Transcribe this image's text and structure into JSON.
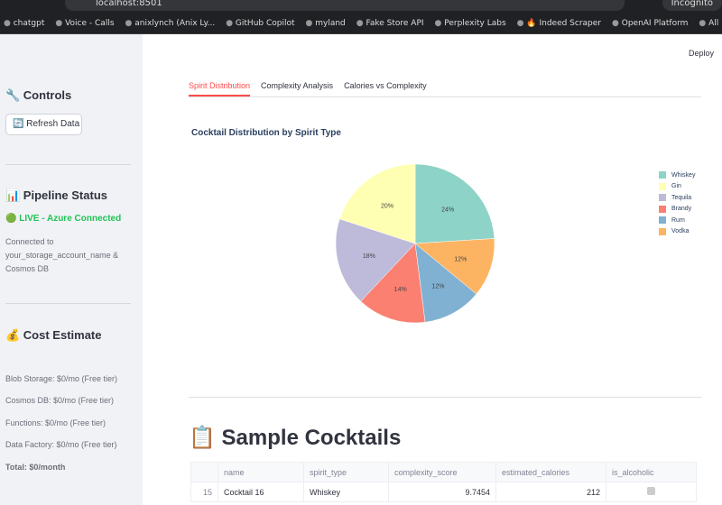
{
  "browser": {
    "url": "localhost:8501",
    "incognito": "Incognito",
    "bookmarks": [
      "chatgpt",
      "Voice - Calls",
      "anixlynch (Anix Ly...",
      "GitHub Copilot",
      "myland",
      "Fake Store API",
      "Perplexity Labs",
      "🔥 Indeed Scraper",
      "OpenAI Platform",
      "All Bookmarks"
    ]
  },
  "sidebar": {
    "controls": "🔧 Controls",
    "refresh": "🔄 Refresh Data",
    "pipeline": "📊 Pipeline Status",
    "live": "🟢 LIVE - Azure Connected",
    "connected": "Connected to your_storage_account_name & Cosmos DB",
    "cost": "💰 Cost Estimate",
    "costs": [
      "Blob Storage: $0/mo (Free tier)",
      "Cosmos DB: $0/mo (Free tier)",
      "Functions: $0/mo (Free tier)",
      "Data Factory: $0/mo (Free tier)"
    ],
    "total": "Total: $0/month"
  },
  "main": {
    "deploy": "Deploy",
    "tabs": [
      "Spirit Distribution",
      "Complexity Analysis",
      "Calories vs Complexity"
    ],
    "active_tab": 0,
    "section": "📋 Sample Cocktails"
  },
  "table": {
    "headers": [
      "",
      "name",
      "spirit_type",
      "complexity_score",
      "estimated_calories",
      "is_alcoholic"
    ],
    "rows": [
      {
        "idx": "15",
        "name": "Cocktail 16",
        "spirit": "Whiskey",
        "complexity": "9.7454",
        "calories": "212",
        "alcoholic": false
      }
    ]
  },
  "chart_data": {
    "type": "pie",
    "title": "Cocktail Distribution by Spirit Type",
    "legend_position": "right",
    "labels": [
      "Whiskey",
      "Gin",
      "Tequila",
      "Brandy",
      "Rum",
      "Vodka"
    ],
    "values": [
      24,
      20,
      18,
      14,
      12,
      12
    ],
    "colors": [
      "#8dd3c7",
      "#ffffb3",
      "#bebada",
      "#fb8072",
      "#80b1d3",
      "#fdb462"
    ]
  }
}
